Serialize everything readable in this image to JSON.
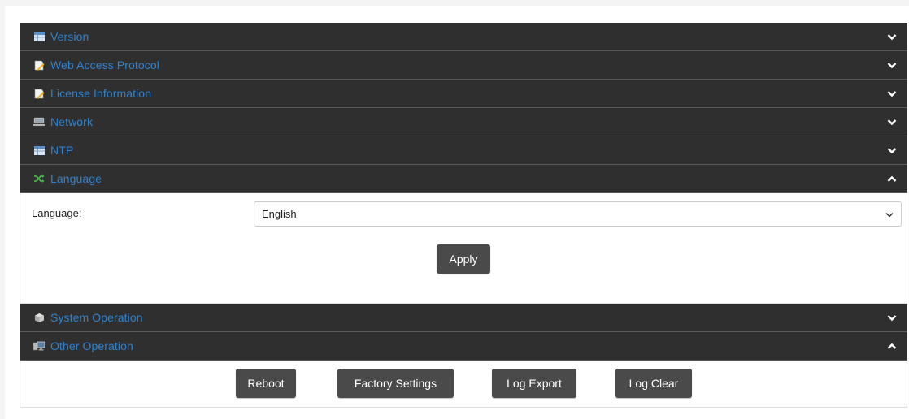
{
  "sections": [
    {
      "title": "Version",
      "icon": "table-icon",
      "state": "collapsed"
    },
    {
      "title": "Web Access Protocol",
      "icon": "document-edit-icon",
      "state": "collapsed"
    },
    {
      "title": "License Information",
      "icon": "document-edit-icon",
      "state": "collapsed"
    },
    {
      "title": "Network",
      "icon": "network-icon",
      "state": "collapsed"
    },
    {
      "title": "NTP",
      "icon": "table-icon",
      "state": "collapsed"
    },
    {
      "title": "Language",
      "icon": "shuffle-icon",
      "state": "expanded"
    },
    {
      "title": "System Operation",
      "icon": "cube-icon",
      "state": "collapsed"
    },
    {
      "title": "Other Operation",
      "icon": "computer-icon",
      "state": "expanded"
    }
  ],
  "language": {
    "label": "Language:",
    "selected": "English",
    "apply_label": "Apply"
  },
  "other_operation": {
    "reboot_label": "Reboot",
    "factory_label": "Factory Settings",
    "log_export_label": "Log Export",
    "log_clear_label": "Log Clear"
  },
  "colors": {
    "header_bg": "#2f2f2f",
    "header_text": "#2f82cf",
    "button_bg": "#4a4a4a"
  }
}
